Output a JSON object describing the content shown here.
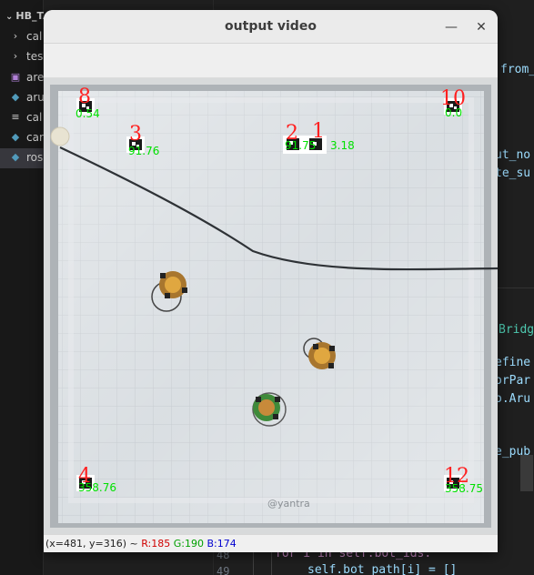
{
  "editor": {
    "explorer_title": "HB_TA",
    "tree": [
      {
        "icon": "chevron-right",
        "glyph": "›",
        "label": "cal",
        "color": "#cccccc"
      },
      {
        "icon": "chevron-right",
        "glyph": "›",
        "label": "tes",
        "color": "#cccccc"
      },
      {
        "icon": "image-file",
        "glyph": "▣",
        "label": "are",
        "color": "#b180d7"
      },
      {
        "icon": "python-file",
        "glyph": "◆",
        "label": "aru",
        "color": "#519aba"
      },
      {
        "icon": "text-file",
        "glyph": "≡",
        "label": "cal",
        "color": "#cccccc"
      },
      {
        "icon": "python-file",
        "glyph": "◆",
        "label": "car",
        "color": "#519aba"
      },
      {
        "icon": "python-file",
        "glyph": "◆",
        "label": "ros",
        "color": "#519aba"
      }
    ],
    "code_fragments": [
      {
        "text": "from_",
        "color": "#9cdcfe"
      },
      {
        "text": "ut_no",
        "color": "#9cdcfe"
      },
      {
        "text": "te_su",
        "color": "#9cdcfe"
      },
      {
        "text": "Bridg",
        "color": "#4ec9b0"
      },
      {
        "text": "efine",
        "color": "#9cdcfe"
      },
      {
        "text": "orPar",
        "color": "#9cdcfe"
      },
      {
        "text": "o.Aru",
        "color": "#9cdcfe"
      },
      {
        "text": "e_pub",
        "color": "#9cdcfe"
      }
    ],
    "line_numbers": [
      "48",
      "49"
    ],
    "code_line_48": "for i in self.bot_ids:",
    "code_line_49": "self.bot_path[i] = []"
  },
  "window": {
    "title": "output video",
    "minimize_label": "—",
    "close_label": "✕"
  },
  "video": {
    "watermark": "@yantra",
    "markers": [
      {
        "id_label": "8",
        "value_label": "0.54"
      },
      {
        "id_label": "10",
        "value_label": "0.0"
      },
      {
        "id_label": "3",
        "value_label": "91.76"
      },
      {
        "id_label": "2",
        "value_label": "91.75"
      },
      {
        "id_label": "1",
        "value_label": "3.18"
      },
      {
        "id_label": "4",
        "value_label": "358.76"
      },
      {
        "id_label": "12",
        "value_label": "358.75"
      }
    ],
    "colors": {
      "id_label": "#ff2020",
      "value_label": "#00e000",
      "boundary_line": "#2e3236"
    }
  },
  "status": {
    "coords": "(x=481, y=316) ~",
    "r": "R:185",
    "g": "G:190",
    "b": "B:174",
    "r_color": "#d00000",
    "g_color": "#00a000",
    "b_color": "#0000d0"
  }
}
